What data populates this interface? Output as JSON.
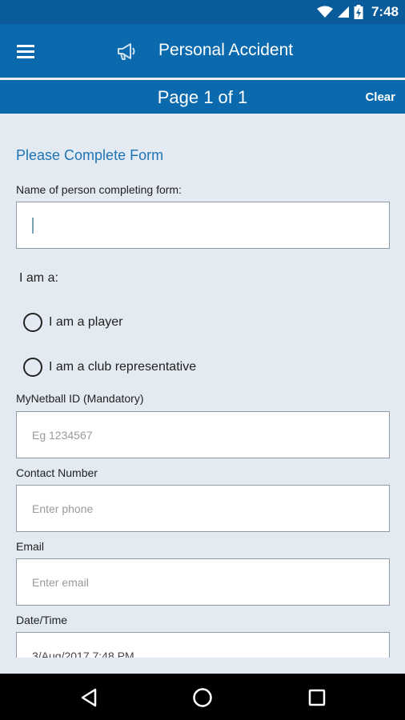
{
  "status_bar": {
    "time": "7:48",
    "icons": [
      "wifi-icon",
      "signal-icon",
      "battery-icon"
    ]
  },
  "app_bar": {
    "title": "Personal Accident",
    "icons": [
      "menu-icon",
      "megaphone-icon"
    ]
  },
  "page_bar": {
    "title": "Page 1 of 1",
    "clear_label": "Clear"
  },
  "form": {
    "heading": "Please Complete Form",
    "name_label": "Name of person completing form:",
    "name_value": "",
    "iam_label": "I am a:",
    "radio_options": [
      {
        "label": "I am a player",
        "selected": false
      },
      {
        "label": "I am a club representative",
        "selected": false
      }
    ],
    "mynetball_label": "MyNetball ID (Mandatory)",
    "mynetball_placeholder": "Eg 1234567",
    "contact_label": "Contact Number",
    "contact_placeholder": "Enter phone",
    "email_label": "Email",
    "email_placeholder": "Enter email",
    "datetime_label": "Date/Time",
    "datetime_value": "3/Aug/2017 7:48 PM"
  },
  "nav_bar": {
    "icons": [
      "back-icon",
      "home-icon",
      "recents-icon"
    ]
  },
  "colors": {
    "app_bar": "#0a6aad",
    "status_bar": "#0a5b99",
    "background": "#e3eaf1",
    "heading": "#1e74b5"
  }
}
